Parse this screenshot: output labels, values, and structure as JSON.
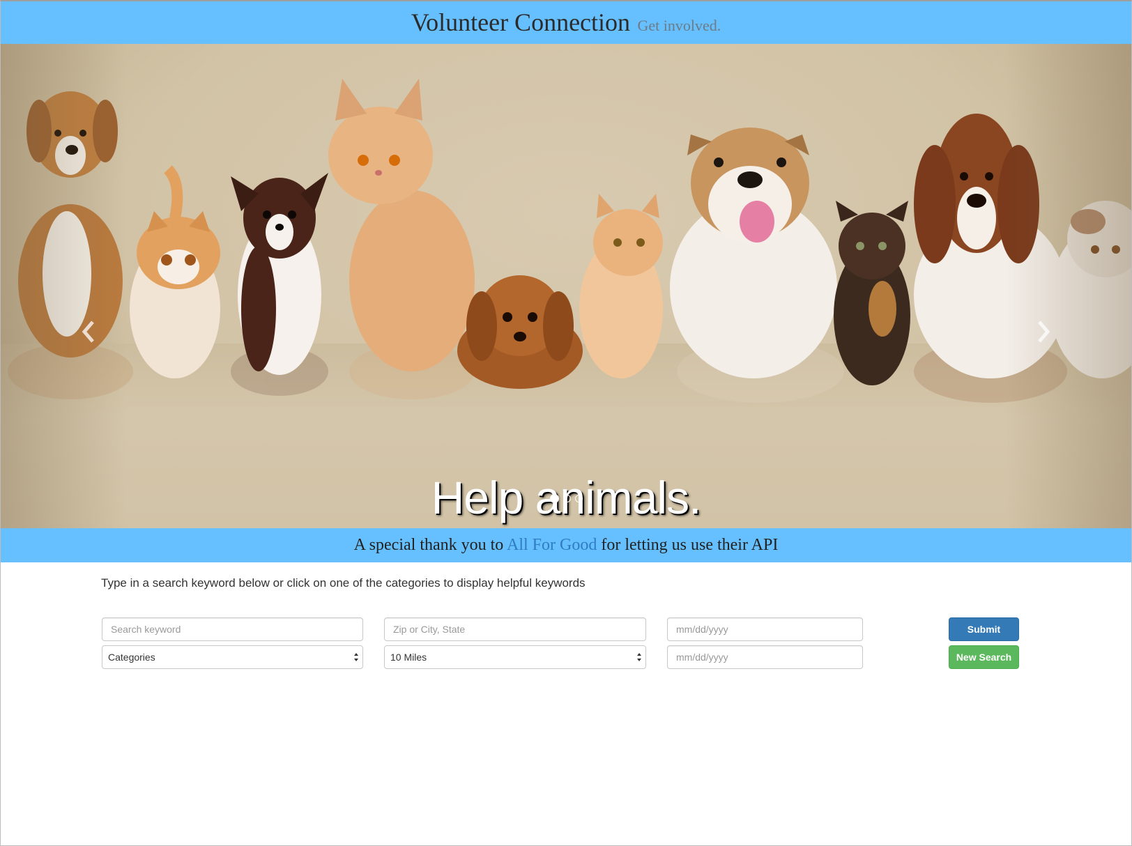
{
  "header": {
    "title": "Volunteer Connection",
    "tagline": "Get involved."
  },
  "carousel": {
    "caption": "Help animals.",
    "slide_count": 3,
    "active_slide": 1,
    "prev_icon": "chevron-left-icon",
    "next_icon": "chevron-right-icon"
  },
  "thanks": {
    "before": "A special thank you to",
    "link": "All For Good",
    "after": "for letting us use their API"
  },
  "search": {
    "instructions": "Type in a search keyword below or click on one of the categories to display helpful keywords",
    "keyword_placeholder": "Search keyword",
    "location_placeholder": "Zip or City, State",
    "start_date_placeholder": "mm/dd/yyyy",
    "end_date_placeholder": "mm/dd/yyyy",
    "category_selected": "Categories",
    "distance_selected": "10 Miles",
    "submit_label": "Submit",
    "new_search_label": "New Search"
  },
  "colors": {
    "banner": "#66c0ff",
    "submit": "#337ab7",
    "new_search": "#5cb85c",
    "link": "#2f7cc4"
  }
}
